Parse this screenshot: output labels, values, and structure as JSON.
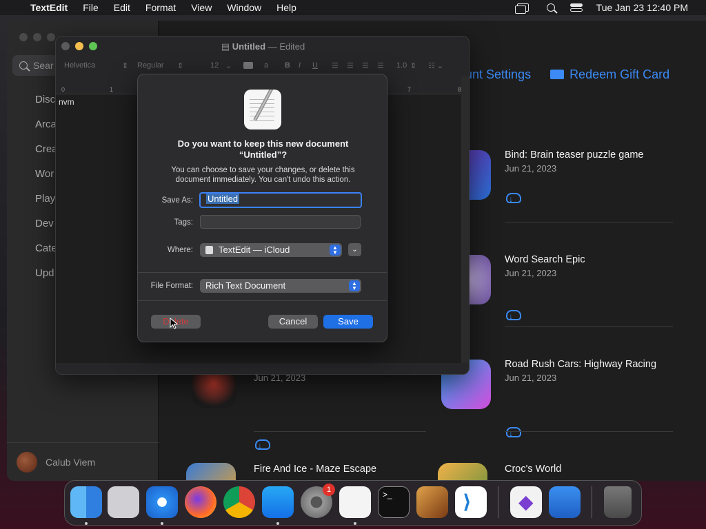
{
  "menubar": {
    "app_name": "TextEdit",
    "items": [
      "File",
      "Edit",
      "Format",
      "View",
      "Window",
      "Help"
    ],
    "clock": "Tue Jan 23  12:40 PM"
  },
  "appstore": {
    "search_placeholder": "Sear",
    "sidebar": [
      "Disc",
      "Arca",
      "Crea",
      "Wor",
      "Play",
      "Dev",
      "Cate",
      "Upd"
    ],
    "user_name": "Calub Viem",
    "top_links": {
      "account_settings": "unt Settings",
      "redeem": "Redeem Gift Card"
    },
    "apps": [
      {
        "title": "Bind: Brain teaser puzzle game",
        "date": "Jun 21, 2023"
      },
      {
        "title": "Word Search Epic",
        "date": "Jun 21, 2023"
      },
      {
        "title": "Road Rush Cars: Highway Racing",
        "date": "Jun 21, 2023"
      },
      {
        "title": "",
        "date": "Jun 21, 2023"
      },
      {
        "title": "Fire And Ice - Maze Escape",
        "date": ""
      },
      {
        "title": "Croc's World",
        "date": ""
      }
    ]
  },
  "textedit": {
    "title": "Untitled",
    "title_suffix": "— Edited",
    "toolbar": {
      "font": "Helvetica",
      "style": "Regular",
      "size": "12",
      "spacing": "1.0"
    },
    "ruler": [
      "0",
      "1",
      "7",
      "8"
    ],
    "content": "nvm"
  },
  "dialog": {
    "heading_line1": "Do you want to keep this new document",
    "heading_line2": "“Untitled”?",
    "body": "You can choose to save your changes, or delete this document immediately. You can't undo this action.",
    "save_as_label": "Save As:",
    "save_as_value": "Untitled",
    "tags_label": "Tags:",
    "where_label": "Where:",
    "where_value": "TextEdit — iCloud",
    "format_label": "File Format:",
    "format_value": "Rich Text Document",
    "delete_label": "Delete",
    "cancel_label": "Cancel",
    "save_label": "Save"
  },
  "dock": {
    "badge": "1",
    "apps": [
      "Finder",
      "Launchpad",
      "Safari",
      "Firefox",
      "Chrome",
      "App Store",
      "System Settings",
      "TextEdit",
      "Terminal",
      "GarageBand",
      "Visual Studio Code",
      "Visual Studio",
      "Weather",
      "Trash"
    ]
  },
  "colors": {
    "accent": "#1f6fe5",
    "link": "#3b8af6",
    "danger": "#d23a3a"
  }
}
